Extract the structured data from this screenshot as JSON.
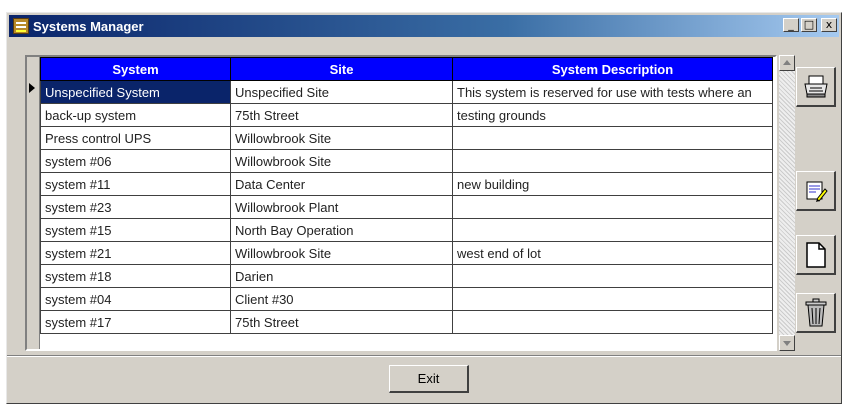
{
  "window": {
    "title": "Systems Manager",
    "controls": {
      "minimize": "_",
      "maximize": "□",
      "close": "x"
    }
  },
  "grid": {
    "columns": [
      "System",
      "Site",
      "System Description"
    ],
    "rows": [
      {
        "system": "Unspecified System",
        "site": "Unspecified Site",
        "description": "This system is reserved for use with tests where an"
      },
      {
        "system": "back-up system",
        "site": "75th Street",
        "description": "testing grounds"
      },
      {
        "system": "Press control UPS",
        "site": "Willowbrook Site",
        "description": ""
      },
      {
        "system": "system #06",
        "site": "Willowbrook Site",
        "description": ""
      },
      {
        "system": "system #11",
        "site": "Data Center",
        "description": "new building"
      },
      {
        "system": "system #23",
        "site": "Willowbrook Plant",
        "description": ""
      },
      {
        "system": "system #15",
        "site": "North Bay Operation",
        "description": ""
      },
      {
        "system": "system #21",
        "site": "Willowbrook Site",
        "description": "west end of lot"
      },
      {
        "system": "system #18",
        "site": "Darien",
        "description": ""
      },
      {
        "system": "system #04",
        "site": "Client #30",
        "description": ""
      },
      {
        "system": "system #17",
        "site": "75th Street",
        "description": ""
      }
    ]
  },
  "side_toolbar": [
    {
      "icon": "printer-icon"
    },
    {
      "icon": "edit-icon"
    },
    {
      "icon": "new-document-icon"
    },
    {
      "icon": "trash-icon"
    }
  ],
  "footer": {
    "exit_label": "Exit"
  }
}
